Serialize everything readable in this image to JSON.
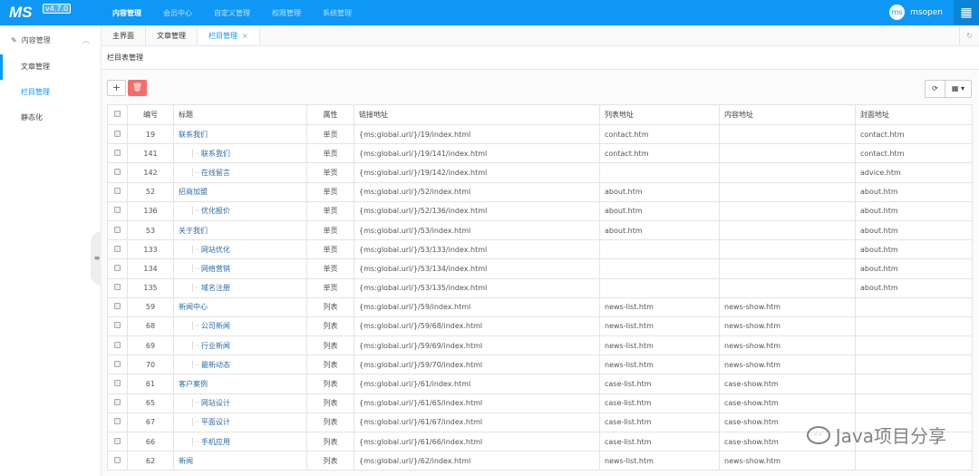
{
  "header": {
    "logo": "MS",
    "version": "v4.7.0",
    "nav": [
      "内容管理",
      "会员中心",
      "自定义管理",
      "权限管理",
      "系统管理"
    ],
    "active_nav": 0,
    "user": {
      "avatar": "ms",
      "name": "msopen"
    },
    "brand_color": "#0e97f5"
  },
  "sidebar": {
    "group": "内容管理",
    "items": [
      {
        "label": "文章管理"
      },
      {
        "label": "栏目管理"
      },
      {
        "label": "静态化"
      }
    ]
  },
  "tabs": [
    {
      "label": "主界面"
    },
    {
      "label": "文章管理"
    },
    {
      "label": "栏目管理",
      "close": "×"
    }
  ],
  "page_title": "栏目表管理",
  "toolbar": {
    "add": "+",
    "delete": "🗑",
    "refresh": "⟳",
    "columns": "▦ ▾"
  },
  "table": {
    "headers": [
      "编号",
      "标题",
      "属性",
      "链接地址",
      "列表地址",
      "内容地址",
      "封面地址"
    ],
    "rows": [
      {
        "id": "19",
        "title": "联系我们",
        "child": false,
        "type": "单页",
        "link": "{ms:global.url/}/19/index.html",
        "list": "contact.htm",
        "content": "",
        "cover": "contact.htm"
      },
      {
        "id": "141",
        "title": "联系我们",
        "child": true,
        "type": "单页",
        "link": "{ms:global.url/}/19/141/index.html",
        "list": "contact.htm",
        "content": "",
        "cover": "contact.htm"
      },
      {
        "id": "142",
        "title": "在线留言",
        "child": true,
        "type": "单页",
        "link": "{ms:global.url/}/19/142/index.html",
        "list": "",
        "content": "",
        "cover": "advice.htm"
      },
      {
        "id": "52",
        "title": "招商加盟",
        "child": false,
        "type": "单页",
        "link": "{ms:global.url/}/52/index.html",
        "list": "about.htm",
        "content": "",
        "cover": "about.htm"
      },
      {
        "id": "136",
        "title": "优化报价",
        "child": true,
        "type": "单页",
        "link": "{ms:global.url/}/52/136/index.html",
        "list": "about.htm",
        "content": "",
        "cover": "about.htm"
      },
      {
        "id": "53",
        "title": "关于我们",
        "child": false,
        "type": "单页",
        "link": "{ms:global.url/}/53/index.html",
        "list": "about.htm",
        "content": "",
        "cover": "about.htm"
      },
      {
        "id": "133",
        "title": "网站优化",
        "child": true,
        "type": "单页",
        "link": "{ms:global.url/}/53/133/index.html",
        "list": "",
        "content": "",
        "cover": "about.htm"
      },
      {
        "id": "134",
        "title": "网络营销",
        "child": true,
        "type": "单页",
        "link": "{ms:global.url/}/53/134/index.html",
        "list": "",
        "content": "",
        "cover": "about.htm"
      },
      {
        "id": "135",
        "title": "域名注册",
        "child": true,
        "type": "单页",
        "link": "{ms:global.url/}/53/135/index.html",
        "list": "",
        "content": "",
        "cover": "about.htm"
      },
      {
        "id": "59",
        "title": "新闻中心",
        "child": false,
        "type": "列表",
        "link": "{ms:global.url/}/59/index.html",
        "list": "news-list.htm",
        "content": "news-show.htm",
        "cover": ""
      },
      {
        "id": "68",
        "title": "公司新闻",
        "child": true,
        "type": "列表",
        "link": "{ms:global.url/}/59/68/index.html",
        "list": "news-list.htm",
        "content": "news-show.htm",
        "cover": ""
      },
      {
        "id": "69",
        "title": "行业新闻",
        "child": true,
        "type": "列表",
        "link": "{ms:global.url/}/59/69/index.html",
        "list": "news-list.htm",
        "content": "news-show.htm",
        "cover": ""
      },
      {
        "id": "70",
        "title": "最新动态",
        "child": true,
        "type": "列表",
        "link": "{ms:global.url/}/59/70/index.html",
        "list": "news-list.htm",
        "content": "news-show.htm",
        "cover": ""
      },
      {
        "id": "61",
        "title": "客户案例",
        "child": false,
        "type": "列表",
        "link": "{ms:global.url/}/61/index.html",
        "list": "case-list.htm",
        "content": "case-show.htm",
        "cover": ""
      },
      {
        "id": "65",
        "title": "网站设计",
        "child": true,
        "type": "列表",
        "link": "{ms:global.url/}/61/65/index.html",
        "list": "case-list.htm",
        "content": "case-show.htm",
        "cover": ""
      },
      {
        "id": "67",
        "title": "平面设计",
        "child": true,
        "type": "列表",
        "link": "{ms:global.url/}/61/67/index.html",
        "list": "case-list.htm",
        "content": "case-show.htm",
        "cover": ""
      },
      {
        "id": "66",
        "title": "手机应用",
        "child": true,
        "type": "列表",
        "link": "{ms:global.url/}/61/66/index.html",
        "list": "case-list.htm",
        "content": "case-show.htm",
        "cover": ""
      },
      {
        "id": "62",
        "title": "新闻",
        "child": false,
        "type": "列表",
        "link": "{ms:global.url/}/62/index.html",
        "list": "news-list.htm",
        "content": "news-show.htm",
        "cover": ""
      }
    ]
  },
  "watermark": "Java项目分享"
}
